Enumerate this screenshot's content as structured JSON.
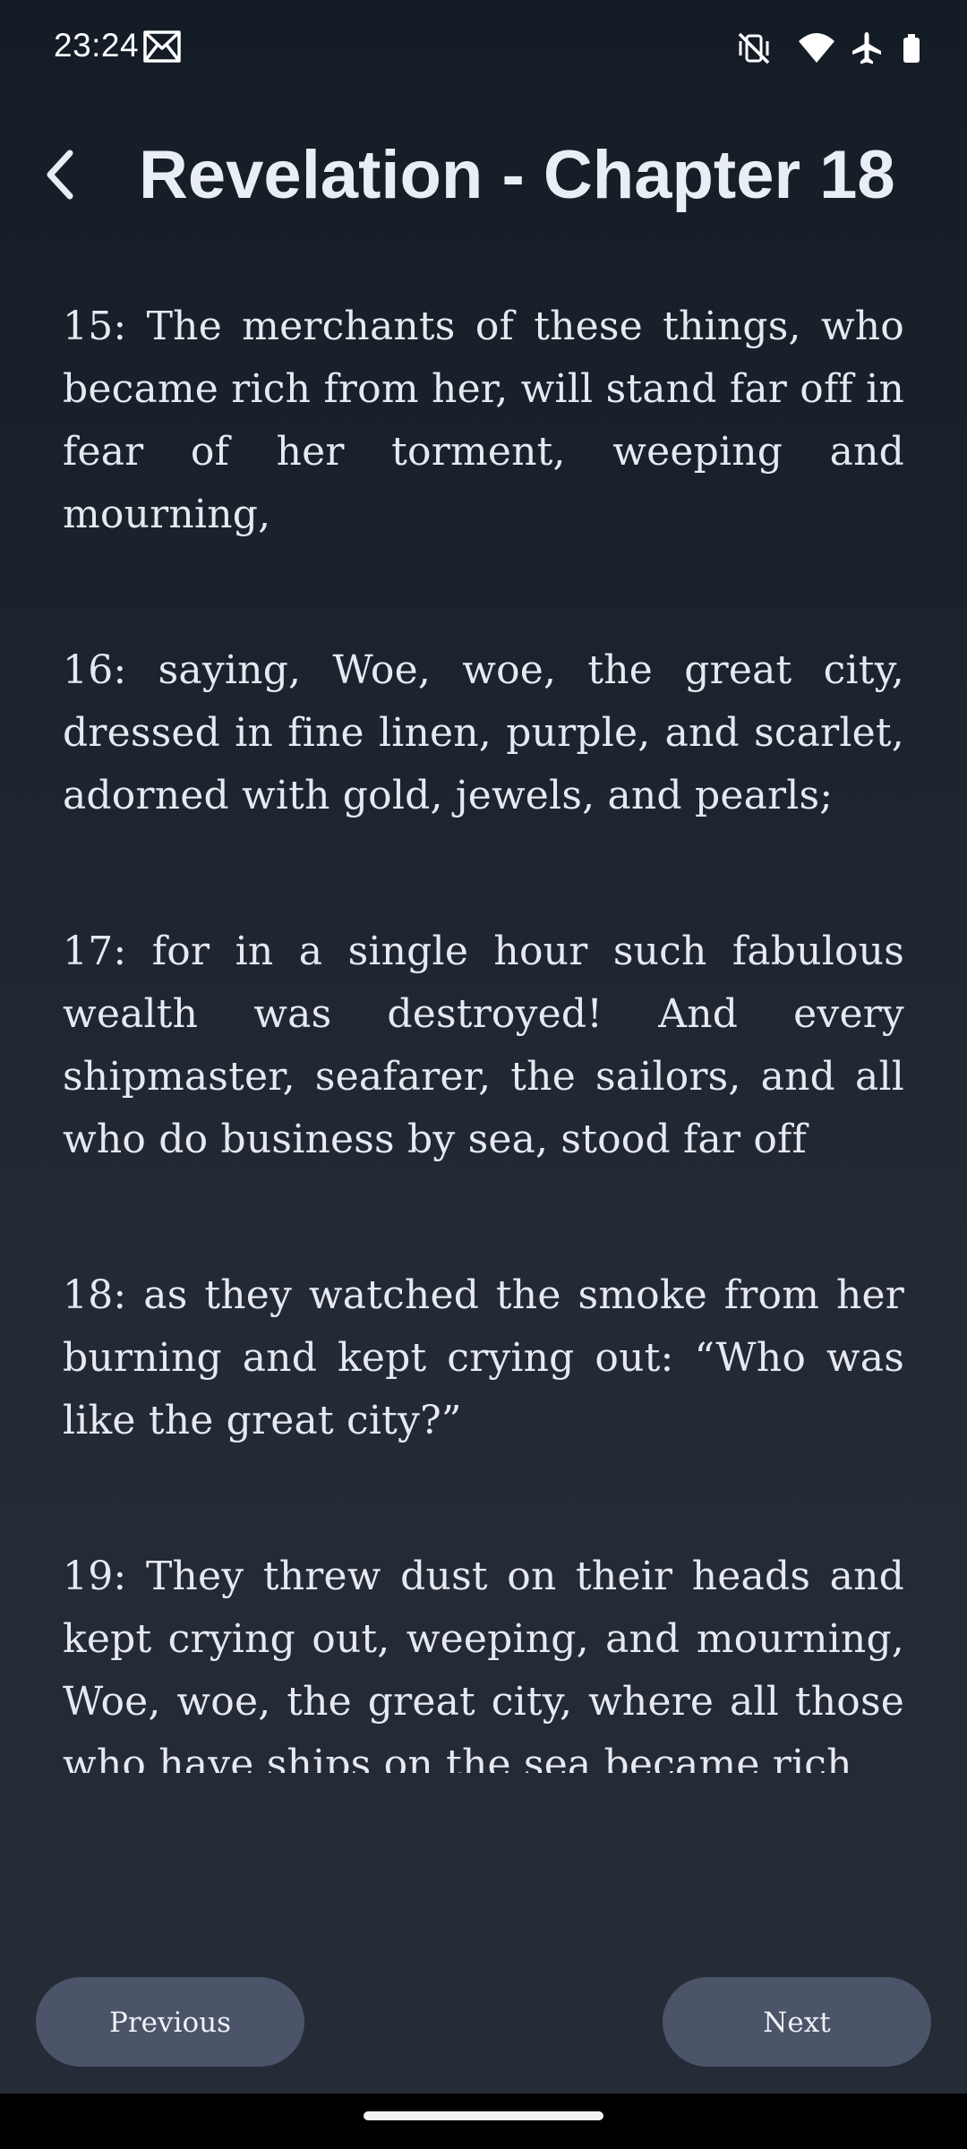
{
  "status_bar": {
    "time": "23:24",
    "icons": [
      "mail-icon",
      "vibrate-off-icon",
      "wifi-icon",
      "airplane-icon",
      "battery-icon"
    ]
  },
  "header": {
    "title": "Revelation - Chapter 18",
    "back_icon": "chevron-left-icon"
  },
  "verses": [
    {
      "text": "15: The merchants of these things, who became rich from her, will stand far off in fear of her torment, weeping and mourning,"
    },
    {
      "text": "16: saying, Woe, woe, the great city, dressed in fine linen, purple, and scarlet, adorned with gold, jewels, and pearls;"
    },
    {
      "text": "17: for in a single hour such fabulous wealth was destroyed! And every shipmaster, seafarer, the sailors, and all who do business by sea, stood far off"
    },
    {
      "text": "18: as they watched the smoke from her burning and kept crying out: “Who was like the great city?”"
    },
    {
      "text": "19: They threw dust on their heads and kept crying out, weeping, and mourning, Woe, woe, the great city, where all those who have ships on the sea became rich"
    }
  ],
  "navigation": {
    "previous_label": "Previous",
    "next_label": "Next"
  },
  "colors": {
    "background_top": "#141c26",
    "background_bottom": "#252c37",
    "button": "#4b5468",
    "text": "#e6eaf0"
  }
}
